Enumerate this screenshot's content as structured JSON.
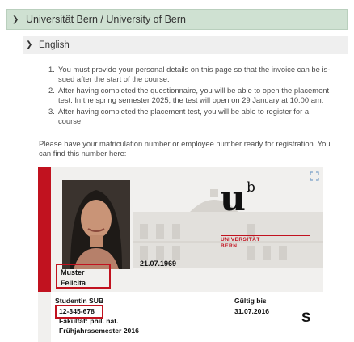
{
  "header": {
    "title": "Universität Bern / University of Bern",
    "icon": "chevron-down-icon"
  },
  "subheader": {
    "title": "English",
    "icon": "chevron-down-icon"
  },
  "steps": [
    {
      "num": "1.",
      "text": "You must provide your personal details on this page so that the invoice can be is-sued after the start of the course."
    },
    {
      "num": "2.",
      "text": "After having completed the questionnaire, you will be able to open the placement test. In the spring semester 2025, the test will open on 29 January at 10:00 am."
    },
    {
      "num": "3.",
      "text": "After having completed the placement test, you will be able to register for a course."
    }
  ],
  "note": "Please have your matriculation number or employee number ready for registration. You can find this number here:",
  "card": {
    "logo_u": "u",
    "logo_b": "b",
    "uni_line1": "UNIVERSITÄT",
    "uni_line2": "BERN",
    "dob": "21.07.1969",
    "last_name": "Muster",
    "first_name": "Felicita",
    "role": "Studentin SUB",
    "matriculation": "12-345-678",
    "faculty": "Fakultät: phil. nat.",
    "semester": "Frühjahrssemester 2016",
    "valid_label": "Gültig bis",
    "valid_date": "31.07.2016",
    "s_letter": "S"
  },
  "colors": {
    "header_bg": "#cfe1d2",
    "subheader_bg": "#efefef",
    "accent_red": "#c1121f"
  }
}
